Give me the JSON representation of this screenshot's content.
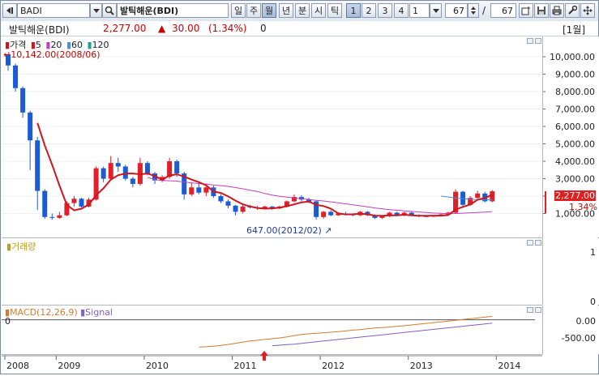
{
  "toolbar": {
    "symbol_code": "BADI",
    "symbol_name": "발틱해운(BDI)",
    "periods": [
      "일",
      "주",
      "월",
      "년",
      "분",
      "시",
      "틱"
    ],
    "active_period": "월",
    "chart_tabs": [
      "1",
      "2",
      "3",
      "4"
    ],
    "count_value": "1",
    "visible_bars": "67",
    "total_bars": "67",
    "separator": "/"
  },
  "infobar": {
    "name": "발틱해운(BDI)",
    "price": "2,277.00",
    "change_symbol": "▲",
    "change": "30.00",
    "change_pct": "(1.34%)",
    "volume": "0",
    "interval_tag": "[1월]"
  },
  "price_pane": {
    "legend": {
      "price": "가격",
      "ma5": "5",
      "ma20": "20",
      "ma60": "60",
      "ma120": "120"
    },
    "high_note": "10,142.00(2008/06)",
    "low_note": "647.00(2012/02)",
    "current_price_tag": "2,277.00",
    "current_pct_tag": "1.34%",
    "y_ticks": [
      "10,000.00",
      "9,000.00",
      "8,000.00",
      "7,000.00",
      "6,000.00",
      "5,000.00",
      "4,000.00",
      "3,000.00",
      "2,000.00",
      "1,000.00"
    ]
  },
  "volume_pane": {
    "title": "거래량",
    "y_ticks": [
      "1",
      "0"
    ]
  },
  "macd_pane": {
    "title": "MACD(12,26,9)",
    "signal": "Signal",
    "zero_label": "0",
    "y_ticks": [
      "0.00",
      "-500.00"
    ]
  },
  "x_axis": {
    "labels": [
      "2008",
      "2009",
      "2010",
      "2011",
      "2012",
      "2013",
      "2014"
    ]
  },
  "colors": {
    "up": "#e0202a",
    "down": "#1c5bd6",
    "ma5": "#d4141c",
    "ma20": "#c040c0",
    "ma60": "#4a90d9",
    "macd": "#d97a2a",
    "signal": "#8060c0",
    "accent": "#cc0000"
  },
  "chart_data": {
    "type": "candlestick",
    "interval": "monthly",
    "start": "2008-06",
    "ylim": [
      0,
      10700
    ],
    "yticks": [
      1000,
      2000,
      3000,
      4000,
      5000,
      6000,
      7000,
      8000,
      9000,
      10000
    ],
    "candles": [
      [
        10142,
        10142,
        9200,
        9500
      ],
      [
        9500,
        9600,
        8000,
        8200
      ],
      [
        8200,
        8300,
        6500,
        6800
      ],
      [
        6800,
        6900,
        3500,
        5200
      ],
      [
        5200,
        5400,
        1200,
        2300
      ],
      [
        2300,
        2400,
        700,
        800
      ],
      [
        800,
        1000,
        650,
        750
      ],
      [
        750,
        1100,
        700,
        900
      ],
      [
        900,
        1700,
        850,
        1600
      ],
      [
        1600,
        2000,
        1400,
        1850
      ],
      [
        1850,
        1900,
        1350,
        1400
      ],
      [
        1400,
        1900,
        1350,
        1800
      ],
      [
        1800,
        3700,
        1750,
        3600
      ],
      [
        3600,
        3700,
        2800,
        3000
      ],
      [
        3000,
        4300,
        2900,
        3900
      ],
      [
        3900,
        4200,
        3400,
        3700
      ],
      [
        3700,
        3800,
        2900,
        3000
      ],
      [
        3000,
        3100,
        2500,
        2700
      ],
      [
        2700,
        4200,
        2600,
        3900
      ],
      [
        3900,
        4000,
        3200,
        3300
      ],
      [
        3300,
        3400,
        2700,
        2900
      ],
      [
        2900,
        3200,
        2800,
        3100
      ],
      [
        3100,
        4200,
        3000,
        4000
      ],
      [
        4000,
        4100,
        3100,
        3300
      ],
      [
        3300,
        3400,
        1800,
        2100
      ],
      [
        2100,
        2800,
        2000,
        2500
      ],
      [
        2500,
        2800,
        2100,
        2200
      ],
      [
        2200,
        2600,
        2000,
        2500
      ],
      [
        2500,
        2600,
        1900,
        2000
      ],
      [
        2000,
        2100,
        1600,
        1700
      ],
      [
        1700,
        1800,
        1300,
        1450
      ],
      [
        1450,
        1500,
        900,
        1100
      ],
      [
        1100,
        1500,
        1000,
        1400
      ],
      [
        1400,
        1500,
        1300,
        1350
      ],
      [
        1350,
        1450,
        1200,
        1300
      ],
      [
        1300,
        1450,
        1250,
        1400
      ],
      [
        1400,
        1450,
        1200,
        1300
      ],
      [
        1300,
        1450,
        1250,
        1400
      ],
      [
        1400,
        1750,
        1350,
        1700
      ],
      [
        1700,
        2100,
        1650,
        1950
      ],
      [
        1950,
        2050,
        1700,
        1800
      ],
      [
        1800,
        1900,
        1600,
        1700
      ],
      [
        1700,
        1750,
        650,
        800
      ],
      [
        800,
        1150,
        700,
        1100
      ],
      [
        1100,
        1200,
        850,
        900
      ],
      [
        900,
        1050,
        850,
        1000
      ],
      [
        1000,
        1100,
        900,
        950
      ],
      [
        950,
        1000,
        850,
        900
      ],
      [
        900,
        1150,
        850,
        1100
      ],
      [
        1100,
        1150,
        850,
        900
      ],
      [
        900,
        950,
        700,
        750
      ],
      [
        750,
        900,
        700,
        850
      ],
      [
        850,
        1100,
        800,
        1050
      ],
      [
        1050,
        1100,
        850,
        900
      ],
      [
        900,
        1100,
        850,
        1050
      ],
      [
        1050,
        1100,
        850,
        900
      ],
      [
        900,
        950,
        800,
        850
      ],
      [
        850,
        900,
        800,
        830
      ],
      [
        830,
        900,
        800,
        870
      ],
      [
        870,
        1000,
        850,
        950
      ],
      [
        950,
        1100,
        900,
        1050
      ],
      [
        1050,
        2400,
        1000,
        2250
      ],
      [
        2250,
        2300,
        1400,
        1500
      ],
      [
        1500,
        2000,
        1450,
        1900
      ],
      [
        1900,
        2300,
        1850,
        2150
      ],
      [
        2150,
        2250,
        1650,
        1700
      ],
      [
        1700,
        2350,
        1650,
        2277
      ]
    ],
    "ma5": [
      null,
      null,
      null,
      null,
      6200,
      4900,
      3800,
      2600,
      1500,
      1180,
      1280,
      1520,
      2050,
      2450,
      2950,
      3200,
      3300,
      3300,
      3250,
      3300,
      3150,
      2950,
      3180,
      3250,
      3120,
      2950,
      2800,
      2620,
      2260,
      2180,
      1980,
      1740,
      1530,
      1400,
      1320,
      1280,
      1300,
      1340,
      1420,
      1530,
      1640,
      1690,
      1500,
      1430,
      1280,
      1010,
      950,
      960,
      990,
      960,
      880,
      870,
      900,
      900,
      930,
      900,
      870,
      870,
      880,
      880,
      910,
      1230,
      1380,
      1520,
      1790,
      1900,
      2077
    ],
    "ma20": [
      null,
      null,
      null,
      null,
      null,
      null,
      null,
      null,
      null,
      null,
      null,
      null,
      null,
      null,
      null,
      null,
      null,
      null,
      null,
      3080,
      2950,
      2900,
      2880,
      2860,
      2810,
      2760,
      2720,
      2690,
      2640,
      2600,
      2560,
      2490,
      2420,
      2340,
      2260,
      2150,
      2060,
      1990,
      1940,
      1900,
      1850,
      1810,
      1760,
      1720,
      1670,
      1620,
      1560,
      1500,
      1440,
      1380,
      1320,
      1270,
      1220,
      1190,
      1150,
      1120,
      1090,
      1060,
      1030,
      1010,
      990,
      1000,
      1020,
      1040,
      1060,
      1080,
      1110
    ],
    "ma60": [
      null,
      null,
      null,
      null,
      null,
      null,
      null,
      null,
      null,
      null,
      null,
      null,
      null,
      null,
      null,
      null,
      null,
      null,
      null,
      null,
      null,
      null,
      null,
      null,
      null,
      null,
      null,
      null,
      null,
      null,
      null,
      null,
      null,
      null,
      null,
      null,
      null,
      null,
      null,
      null,
      null,
      null,
      null,
      null,
      null,
      null,
      null,
      null,
      null,
      null,
      null,
      null,
      null,
      null,
      null,
      null,
      null,
      null,
      null,
      2000,
      1950,
      1900,
      1850,
      1820,
      1800,
      1790,
      1780
    ],
    "macd": [
      null,
      null,
      null,
      null,
      null,
      null,
      null,
      null,
      null,
      null,
      null,
      null,
      null,
      null,
      null,
      null,
      null,
      null,
      null,
      null,
      null,
      null,
      null,
      null,
      null,
      null,
      -1050,
      -1040,
      -1020,
      -990,
      -950,
      -910,
      -860,
      -820,
      -790,
      -760,
      -730,
      -700,
      -660,
      -610,
      -570,
      -540,
      -520,
      -500,
      -480,
      -460,
      -430,
      -400,
      -380,
      -350,
      -320,
      -300,
      -280,
      -250,
      -230,
      -200,
      -170,
      -140,
      -110,
      -80,
      -50,
      -20,
      10,
      40,
      70,
      100,
      130
    ],
    "signal": [
      null,
      null,
      null,
      null,
      null,
      null,
      null,
      null,
      null,
      null,
      null,
      null,
      null,
      null,
      null,
      null,
      null,
      null,
      null,
      null,
      null,
      null,
      null,
      null,
      null,
      null,
      null,
      null,
      null,
      null,
      null,
      null,
      null,
      null,
      null,
      null,
      -1000,
      -980,
      -960,
      -940,
      -910,
      -880,
      -850,
      -820,
      -790,
      -760,
      -730,
      -700,
      -670,
      -640,
      -610,
      -580,
      -550,
      -520,
      -490,
      -460,
      -430,
      -400,
      -370,
      -340,
      -310,
      -280,
      -250,
      -220,
      -190,
      -160,
      -130
    ],
    "macd_ylim": [
      -1200,
      300
    ],
    "volume": "0",
    "x_labels": [
      {
        "label": "2008",
        "index": 0
      },
      {
        "label": "2009",
        "index": 7
      },
      {
        "label": "2010",
        "index": 19
      },
      {
        "label": "2011",
        "index": 31
      },
      {
        "label": "2012",
        "index": 43
      },
      {
        "label": "2013",
        "index": 55
      },
      {
        "label": "2014",
        "index": 67
      }
    ]
  }
}
